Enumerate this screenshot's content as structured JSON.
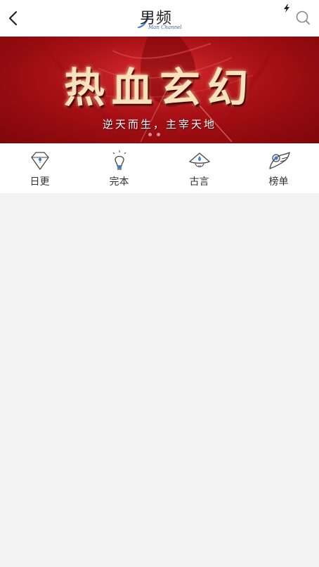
{
  "header": {
    "title": "男频",
    "subtitle": "Man Channel",
    "back_icon": "chevron-left-icon",
    "search_icon": "search-icon",
    "flash_icon": "lightning-icon"
  },
  "banner": {
    "title": "热血玄幻",
    "subtitle": "逆天而生，主宰天地",
    "slide_count": 2,
    "active_slide": 1,
    "colors": {
      "background": "#b3141a",
      "title": "#f8e2bd"
    }
  },
  "categories": [
    {
      "label": "日更",
      "icon": "diamond-icon"
    },
    {
      "label": "完本",
      "icon": "lightbulb-icon"
    },
    {
      "label": "古言",
      "icon": "hat-icon"
    },
    {
      "label": "榜单",
      "icon": "eye-wing-icon"
    }
  ],
  "colors": {
    "page_background": "#f3f3f3",
    "accent": "#3a7bd5"
  }
}
